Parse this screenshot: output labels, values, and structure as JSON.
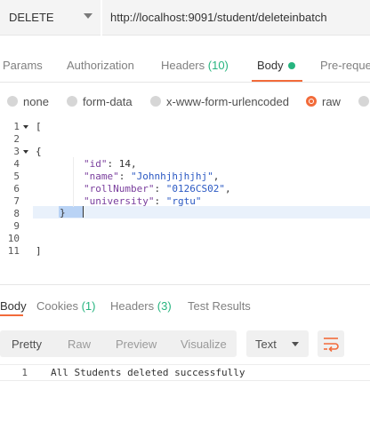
{
  "request": {
    "method": "DELETE",
    "url": "http://localhost:9091/student/deleteinbatch"
  },
  "request_tabs": [
    {
      "label": "Params"
    },
    {
      "label": "Authorization"
    },
    {
      "label": "Headers",
      "count": "(10)"
    },
    {
      "label": "Body",
      "active": true
    },
    {
      "label": "Pre-reque"
    }
  ],
  "body_types": [
    {
      "label": "none"
    },
    {
      "label": "form-data"
    },
    {
      "label": "x-www-form-urlencoded"
    },
    {
      "label": "raw",
      "selected": true
    }
  ],
  "editor": {
    "line_numbers": [
      "1",
      "2",
      "3",
      "4",
      "5",
      "6",
      "7",
      "8",
      "9",
      "10",
      "11"
    ],
    "lines": {
      "l1": "[",
      "l3": "{",
      "l4_key": "\"id\"",
      "l4_rest": ": 14,",
      "l5_key": "\"name\"",
      "l5_sep": ": ",
      "l5_val": "\"Johnhjhjhjhj\"",
      "l5_end": ",",
      "l6_key": "\"rollNumber\"",
      "l6_sep": ": ",
      "l6_val": "\"0126CS02\"",
      "l6_end": ",",
      "l7_key": "\"university\"",
      "l7_sep": ": ",
      "l7_val": "\"rgtu\"",
      "l8": "}",
      "l11": "]"
    }
  },
  "response_tabs": [
    {
      "label": "Body",
      "active": true
    },
    {
      "label": "Cookies",
      "count": "(1)"
    },
    {
      "label": "Headers",
      "count": "(3)"
    },
    {
      "label": "Test Results"
    }
  ],
  "response_view": {
    "buttons": [
      "Pretty",
      "Raw",
      "Preview",
      "Visualize"
    ],
    "format": "Text",
    "line_number": "1",
    "body": "All Students deleted successfully"
  },
  "colors": {
    "accent": "#f26b3a",
    "count_green": "#26b47f",
    "json_key": "#7a3e9d",
    "json_string": "#2b59c3"
  },
  "icons": {
    "method_dropdown": "chevron-down-icon",
    "body_indicator": "dot-icon",
    "format_dropdown": "chevron-down-icon",
    "wrap": "wrap-lines-icon",
    "fold": "fold-arrow-icon"
  }
}
